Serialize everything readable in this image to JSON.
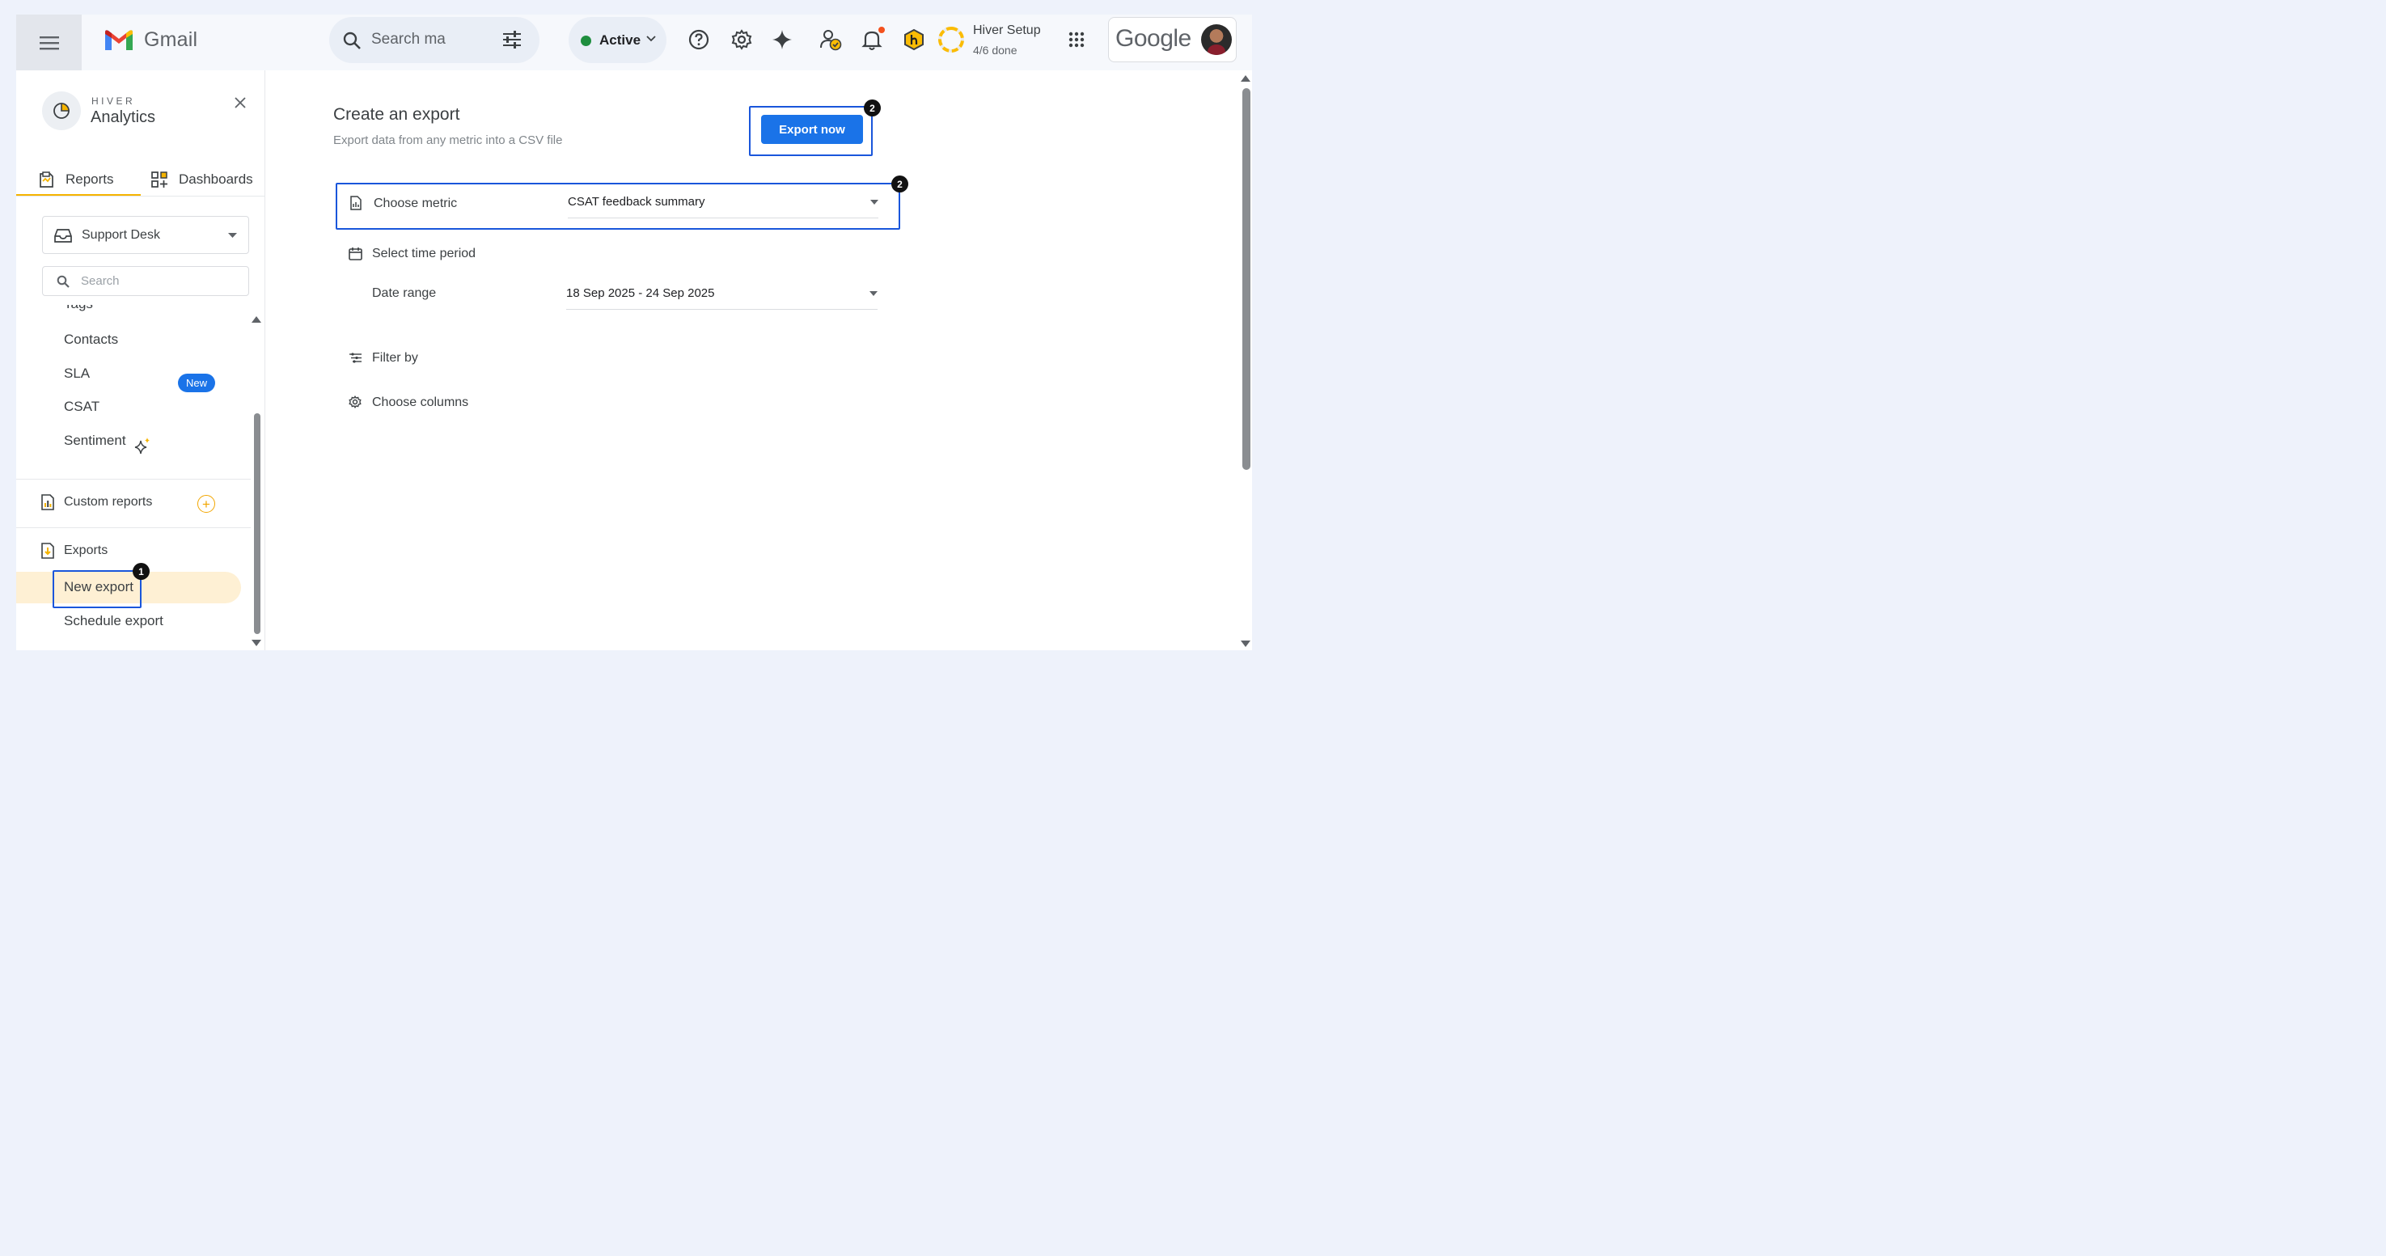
{
  "app": {
    "name": "Gmail",
    "search_placeholder": "Search ma",
    "status": "Active",
    "setup_title": "Hiver Setup",
    "setup_progress": "4/6 done",
    "setup_progress_value": 0.67,
    "account_brand": "Google"
  },
  "sidebar": {
    "brand_small": "HIVER",
    "brand_big": "Analytics",
    "tabs": [
      {
        "label": "Reports",
        "active": true
      },
      {
        "label": "Dashboards",
        "active": false
      }
    ],
    "desk_select": "Support Desk",
    "search_placeholder": "Search",
    "items": [
      {
        "label": "Tags"
      },
      {
        "label": "Contacts"
      },
      {
        "label": "SLA",
        "badge": "New"
      },
      {
        "label": "CSAT"
      },
      {
        "label": "Sentiment"
      }
    ],
    "custom_reports": "Custom reports",
    "exports": "Exports",
    "export_items": [
      {
        "label": "New export",
        "selected": true
      },
      {
        "label": "Schedule export",
        "selected": false
      }
    ]
  },
  "main": {
    "title": "Create an export",
    "subtitle": "Export data from any metric into a CSV file",
    "export_button": "Export now",
    "choose_metric_label": "Choose metric",
    "choose_metric_value": "CSAT feedback summary",
    "time_period_label": "Select time period",
    "date_range_label": "Date range",
    "date_range_value": "18 Sep 2025 - 24 Sep 2025",
    "filter_label": "Filter by",
    "columns_label": "Choose columns"
  },
  "annotations": {
    "step_1": "1",
    "step_2a": "2",
    "step_2b": "2"
  },
  "colors": {
    "accent": "#1a73e8",
    "highlight": "#1a56db",
    "hiver_yellow": "#f5b400",
    "active_green": "#1e8e3e"
  }
}
